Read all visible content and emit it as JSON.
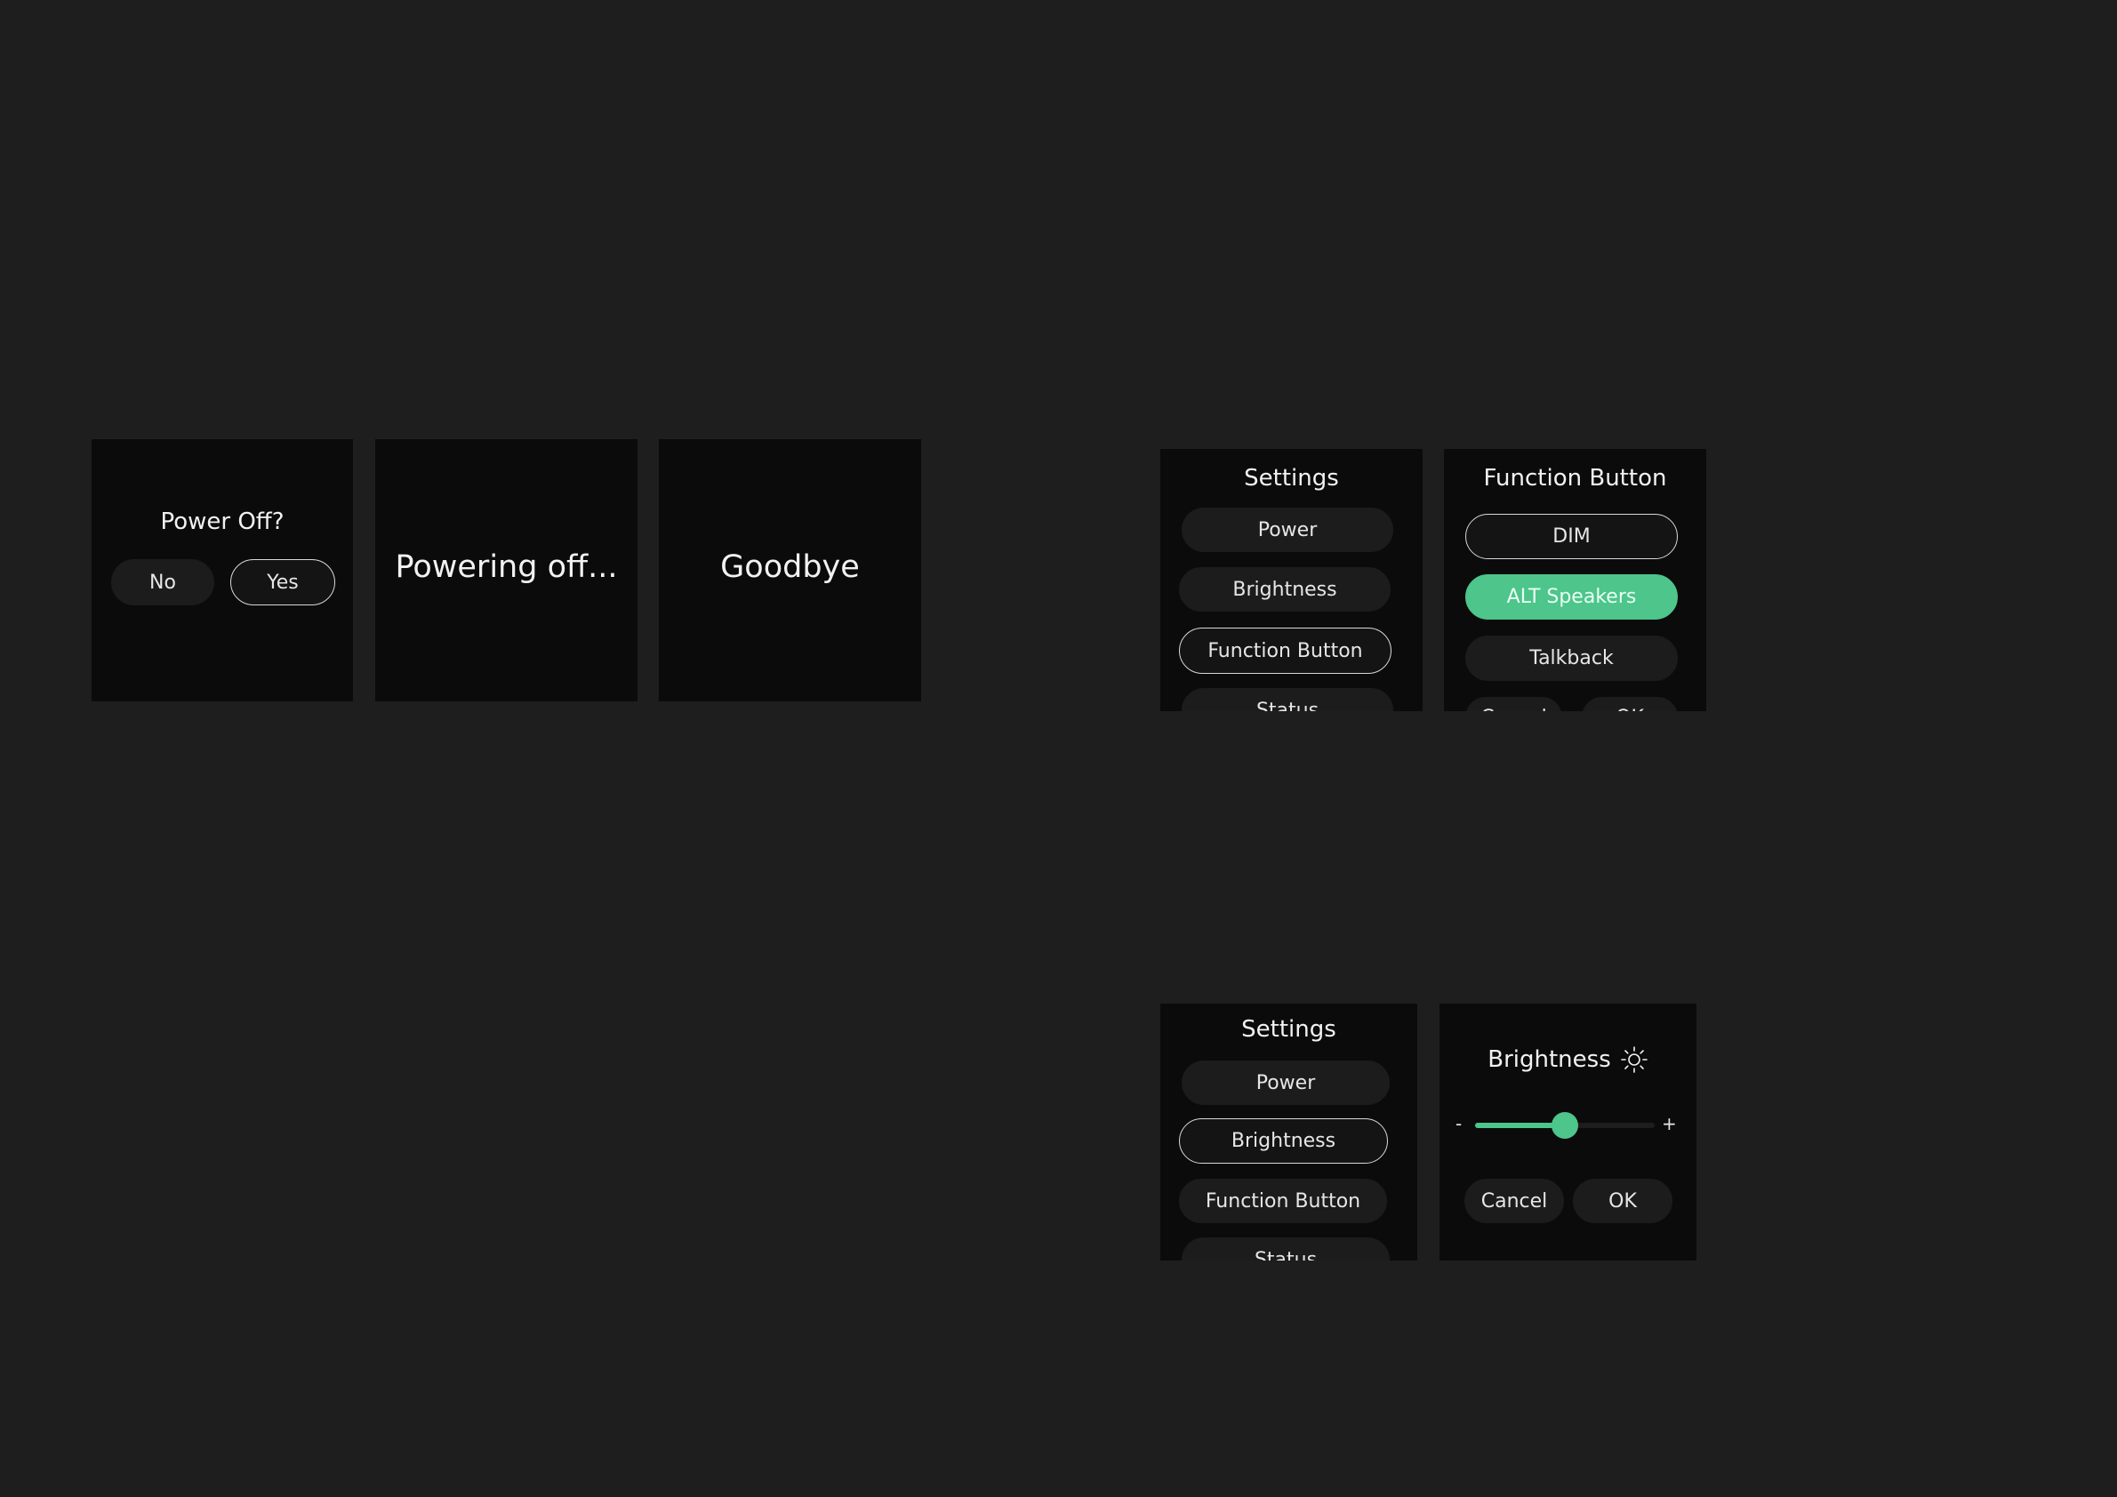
{
  "power_off_dialog": {
    "title": "Power Off?",
    "no_label": "No",
    "yes_label": "Yes"
  },
  "powering_off": {
    "text": "Powering off..."
  },
  "goodbye": {
    "text": "Goodbye"
  },
  "settings_menu_1": {
    "title": "Settings",
    "items": [
      "Power",
      "Brightness",
      "Function Button",
      "Status"
    ],
    "selected_index": 2
  },
  "function_button_menu": {
    "title": "Function Button",
    "options": [
      "DIM",
      "ALT Speakers",
      "Talkback"
    ],
    "focused_index": 0,
    "active_index": 1,
    "cancel_label": "Cancel",
    "ok_label": "OK"
  },
  "settings_menu_2": {
    "title": "Settings",
    "items": [
      "Power",
      "Brightness",
      "Function Button",
      "Status"
    ],
    "selected_index": 1
  },
  "brightness_panel": {
    "title": "Brightness",
    "icon": "sun-icon",
    "minus_label": "-",
    "plus_label": "+",
    "level_fraction": 0.5,
    "cancel_label": "Cancel",
    "ok_label": "OK"
  },
  "colors": {
    "background": "#1e1e1e",
    "screen": "#0b0b0b",
    "accent": "#4dc58b",
    "pill": "#1c1c1c"
  }
}
